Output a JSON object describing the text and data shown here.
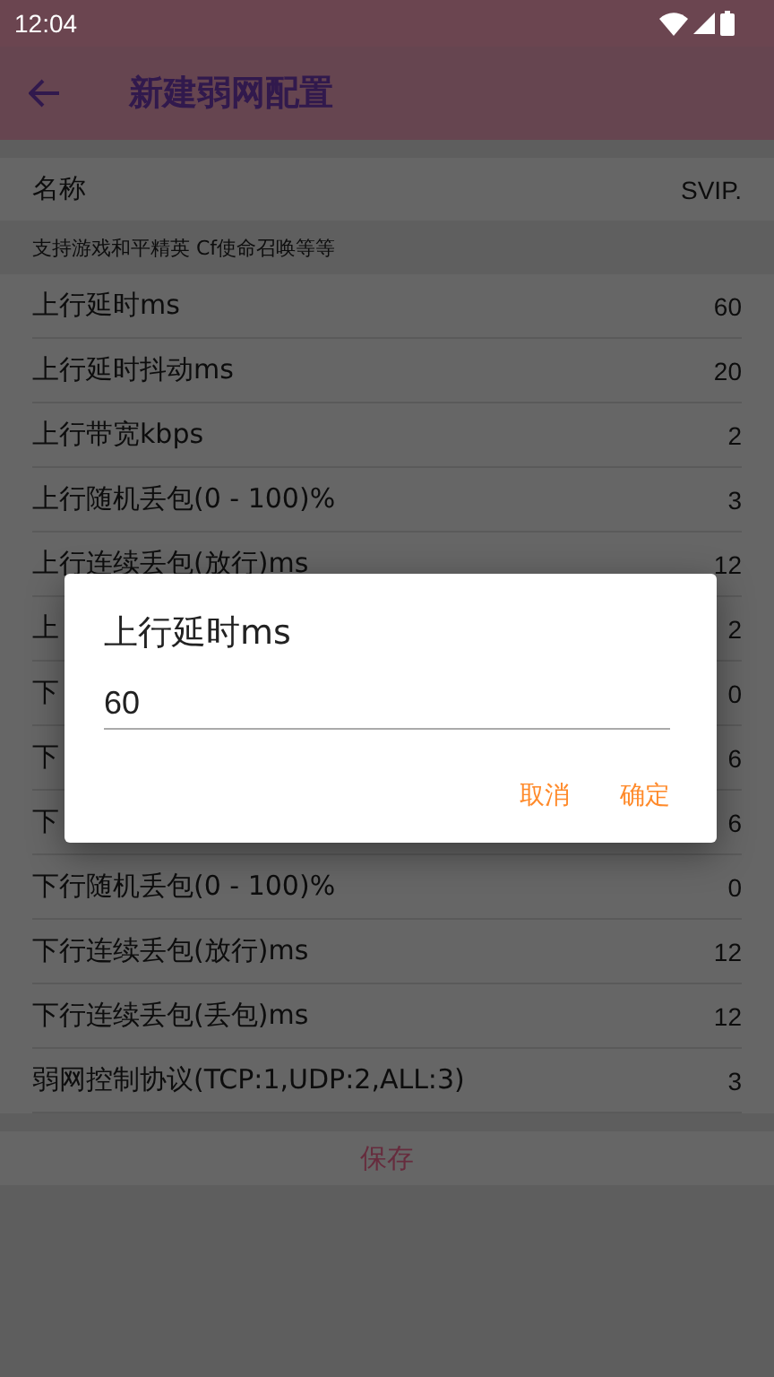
{
  "status_bar": {
    "time": "12:04"
  },
  "app_bar": {
    "title": "新建弱网配置"
  },
  "name_row": {
    "label": "名称",
    "value": "SVIP."
  },
  "hint": "支持游戏和平精英 Cf使命召唤等等",
  "settings": [
    {
      "label": "上行延时ms",
      "value": "60"
    },
    {
      "label": "上行延时抖动ms",
      "value": "20"
    },
    {
      "label": "上行带宽kbps",
      "value": "2"
    },
    {
      "label": "上行随机丢包(0 - 100)%",
      "value": "3"
    },
    {
      "label": "上行连续丢包(放行)ms",
      "value": "12"
    },
    {
      "label": "上",
      "value": "2"
    },
    {
      "label": "下",
      "value": "0"
    },
    {
      "label": "下",
      "value": "6"
    },
    {
      "label": "下",
      "value": "6"
    },
    {
      "label": "下行随机丢包(0 - 100)%",
      "value": "0"
    },
    {
      "label": "下行连续丢包(放行)ms",
      "value": "12"
    },
    {
      "label": "下行连续丢包(丢包)ms",
      "value": "12"
    },
    {
      "label": "弱网控制协议(TCP:1,UDP:2,ALL:3)",
      "value": "3"
    }
  ],
  "save_button": "保存",
  "dialog": {
    "title": "上行延时ms",
    "value": "60",
    "buttons": [
      "取消",
      "确定"
    ]
  }
}
